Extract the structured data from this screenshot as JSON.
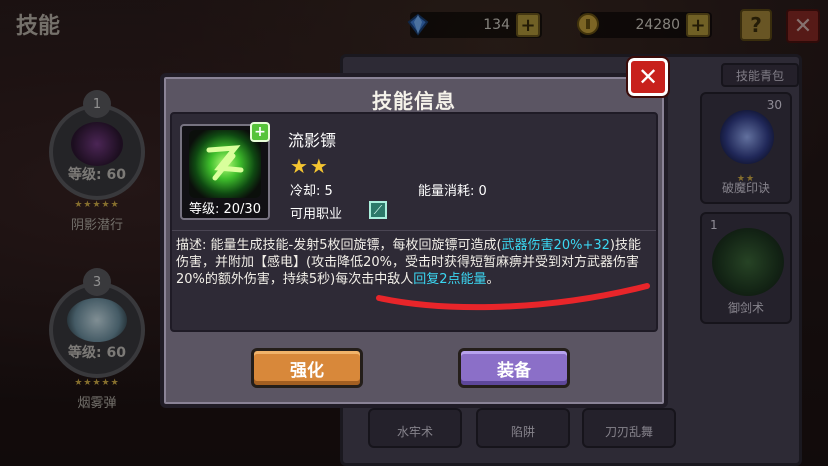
{
  "header": {
    "title": "技能",
    "gems": "134",
    "gold": "24280",
    "help_label": "?",
    "close_label": "✕"
  },
  "left_skills": [
    {
      "num": "1",
      "level": "等级: 60",
      "stars": "★★★★★",
      "name": "阴影潜行"
    },
    {
      "num": "3",
      "level": "等级: 60",
      "stars": "★★★★★",
      "name": "烟雾弹"
    }
  ],
  "panel": {
    "tab_label": "技能青包",
    "cards": [
      {
        "count": "30",
        "stars": "★★",
        "label": "破魔印诀"
      },
      {
        "count": "1",
        "label": "御剑术"
      },
      {
        "label": "水牢术"
      },
      {
        "label": "陷阱"
      },
      {
        "label": "刀刃乱舞"
      }
    ]
  },
  "dialog": {
    "title": "技能信息",
    "close_label": "✕",
    "skill_name": "流影镖",
    "stars": "★★",
    "level": "等级: 20/30",
    "cooldown": "冷却: 5",
    "energy_cost": "能量消耗: 0",
    "job_label": "可用职业",
    "plus_label": "+",
    "desc_1": "描述: 能量生成技能-发射5枚回旋镖，每枚回旋镖可造成(",
    "desc_hl_1": "武器伤害20%+32",
    "desc_2": ")技能伤害，并附加【感电】(攻击降低20%，受击时获得短暂麻痹并受到对方武器伤害20%的额外伤害，持续5秒)每次击中敌人",
    "desc_hl_2": "回复2点能量",
    "desc_3": "。",
    "upgrade_label": "强化",
    "equip_label": "装备"
  },
  "colors": {
    "highlight": "#3bd7f2",
    "star": "#f5c531",
    "upgrade_button": "#d8883a",
    "equip_button": "#8b6fc8",
    "close_button": "#c8211c"
  }
}
